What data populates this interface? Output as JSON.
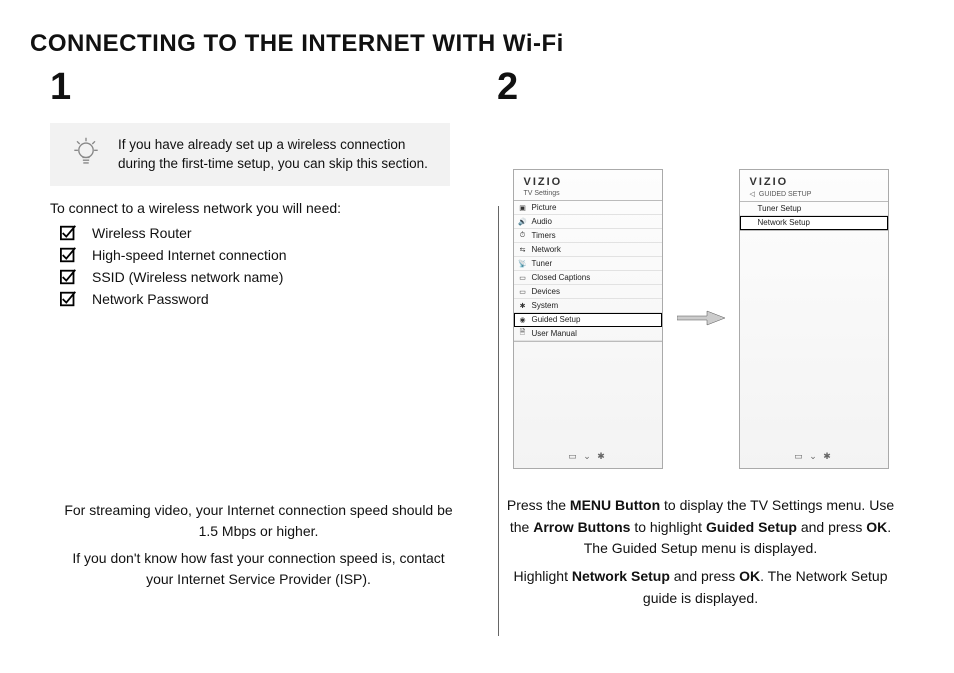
{
  "title": "CONNECTING TO THE INTERNET WITH Wi-Fi",
  "step1": {
    "num": "1",
    "tip": "If you have already set up a wireless connection during the first-time setup, you can skip this section.",
    "need_intro": "To connect to a wireless network you will need:",
    "checklist": [
      "Wireless Router",
      "High-speed Internet connection",
      "SSID (Wireless network name)",
      "Network Password"
    ],
    "note1": "For streaming video, your Internet connection speed should be 1.5 Mbps or higher.",
    "note2": "If you don't know how fast your connection speed is, contact your Internet Service Provider (ISP)."
  },
  "step2": {
    "num": "2",
    "brand": "VIZIO",
    "screen1": {
      "crumb": "TV Settings",
      "items": [
        {
          "icon": "▣",
          "label": "Picture"
        },
        {
          "icon": "🔊",
          "label": "Audio"
        },
        {
          "icon": "⏱",
          "label": "Timers"
        },
        {
          "icon": "⇆",
          "label": "Network"
        },
        {
          "icon": "📡",
          "label": "Tuner"
        },
        {
          "icon": "▭",
          "label": "Closed Captions"
        },
        {
          "icon": "▭",
          "label": "Devices"
        },
        {
          "icon": "✱",
          "label": "System"
        },
        {
          "icon": "◉",
          "label": "Guided Setup",
          "selected": true
        },
        {
          "icon": "🗎",
          "label": "User Manual"
        }
      ]
    },
    "screen2": {
      "crumb": "GUIDED SETUP",
      "items": [
        {
          "label": "Tuner Setup"
        },
        {
          "label": "Network Setup",
          "selected": true
        }
      ]
    },
    "footer_glyphs": "▭  ⌄  ✱",
    "para1_a": "Press the ",
    "para1_b": "MENU Button",
    "para1_c": " to display the TV Settings menu. Use the ",
    "para1_d": "Arrow Buttons",
    "para1_e": " to highlight ",
    "para1_f": "Guided Setup",
    "para1_g": " and press ",
    "para1_h": "OK",
    "para1_i": ". The Guided Setup menu is displayed.",
    "para2_a": "Highlight ",
    "para2_b": "Network Setup",
    "para2_c": " and press ",
    "para2_d": "OK",
    "para2_e": ". The Network Setup guide is displayed."
  }
}
